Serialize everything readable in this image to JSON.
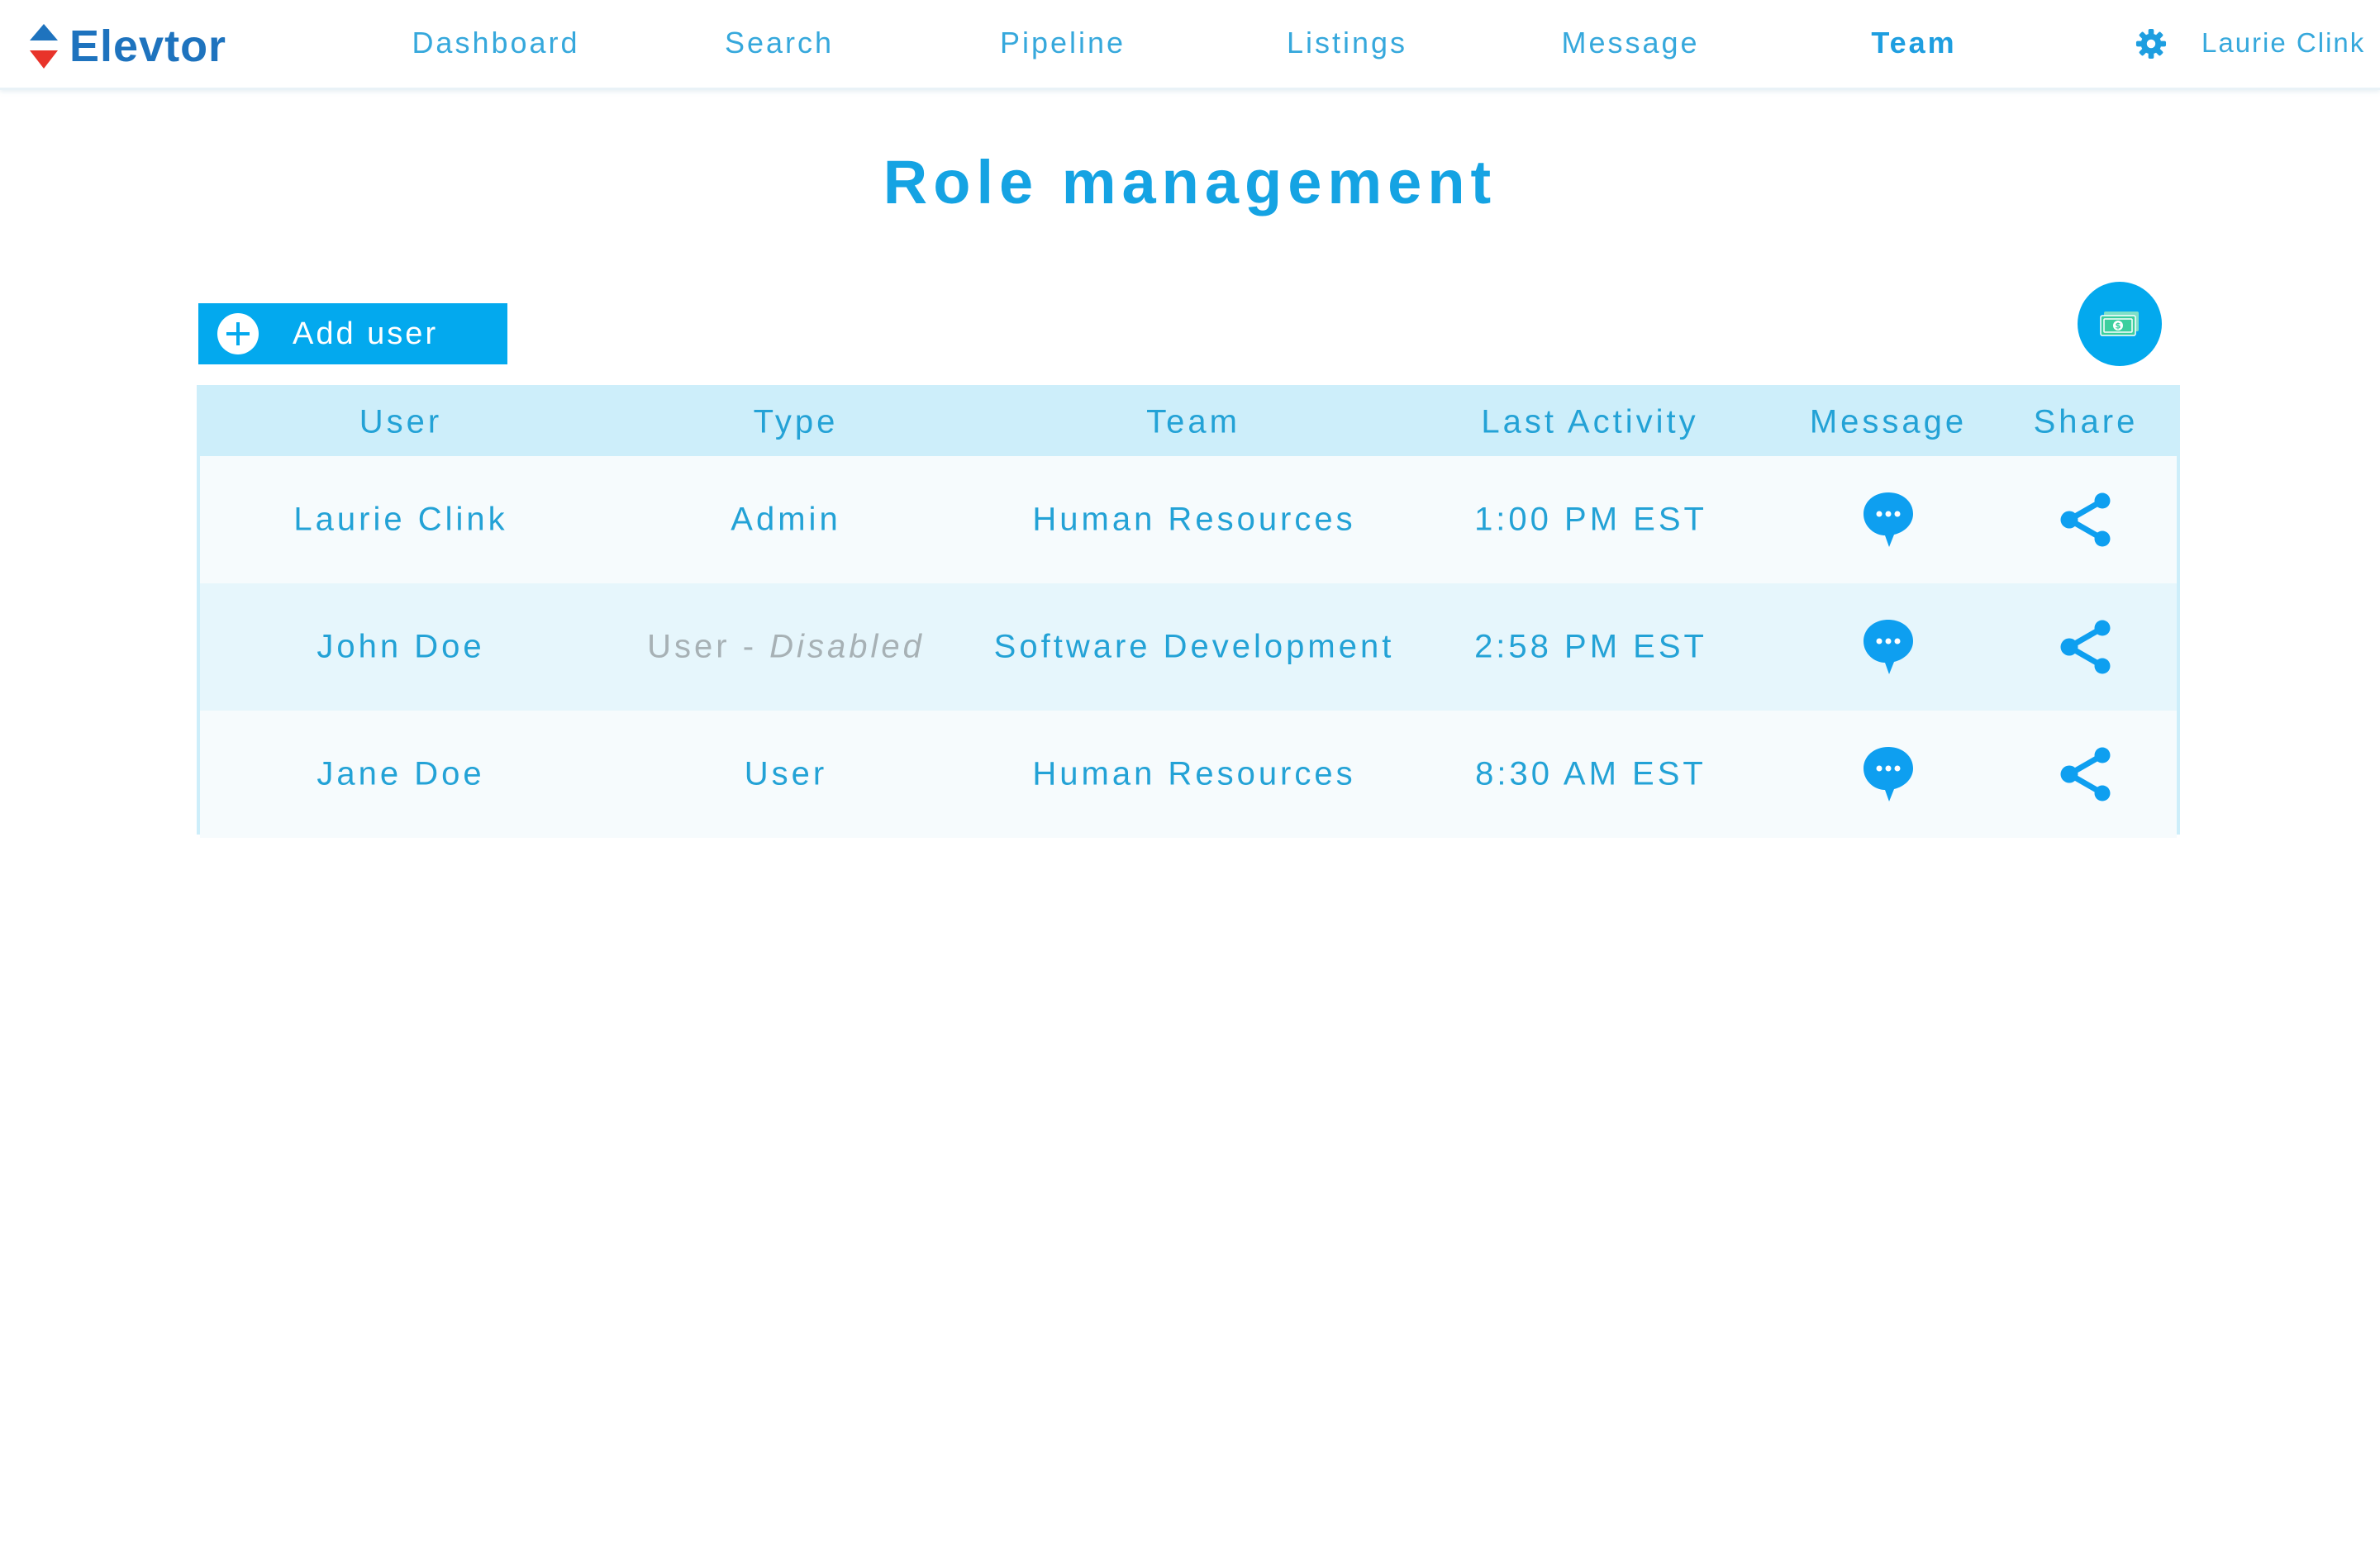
{
  "app": {
    "brand": "Elevtor"
  },
  "nav": {
    "items": [
      {
        "label": "Dashboard",
        "active": false
      },
      {
        "label": "Search",
        "active": false
      },
      {
        "label": "Pipeline",
        "active": false
      },
      {
        "label": "Listings",
        "active": false
      },
      {
        "label": "Message",
        "active": false
      },
      {
        "label": "Team",
        "active": true
      }
    ],
    "user_name": "Laurie Clink",
    "settings_icon": "gear-icon"
  },
  "page": {
    "title": "Role management"
  },
  "toolbar": {
    "add_user_label": "Add user",
    "add_icon": "plus-circle-icon",
    "billing_icon": "money-icon"
  },
  "table": {
    "columns": [
      "User",
      "Type",
      "Team",
      "Last Activity",
      "Message",
      "Share"
    ],
    "rows": [
      {
        "user": "Laurie Clink",
        "type": "Admin",
        "type_prefix": "",
        "type_suffix": "",
        "team": "Human Resources",
        "last_activity": "1:00 PM EST"
      },
      {
        "user": "John Doe",
        "type": "",
        "type_prefix": "User - ",
        "type_suffix": "Disabled",
        "team": "Software Development",
        "last_activity": "2:58 PM EST"
      },
      {
        "user": "Jane Doe",
        "type": "User",
        "type_prefix": "",
        "type_suffix": "",
        "team": "Human Resources",
        "last_activity": "8:30 AM EST"
      }
    ]
  },
  "colors": {
    "accent": "#03a9ee",
    "brand": "#1e73be",
    "text": "#23a2d6",
    "header_row": "#cdeefa",
    "alt_row": "#e6f6fc",
    "disabled_text": "#a7b1b5",
    "logo_top": "#1e73be",
    "logo_bottom": "#e8332a"
  }
}
